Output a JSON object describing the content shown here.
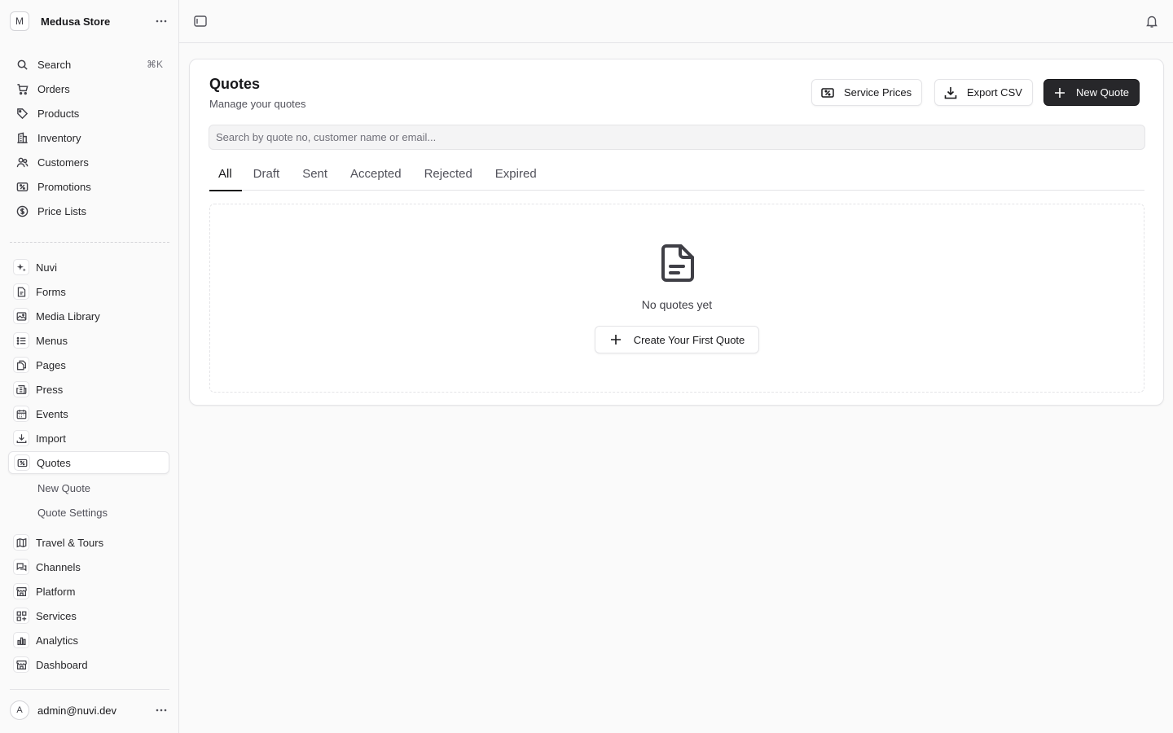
{
  "store": {
    "initial": "M",
    "name": "Medusa Store"
  },
  "search": {
    "label": "Search",
    "shortcut": "⌘K"
  },
  "nav_main": [
    {
      "label": "Orders",
      "icon": "cart-icon"
    },
    {
      "label": "Products",
      "icon": "tag-icon"
    },
    {
      "label": "Inventory",
      "icon": "building-icon"
    },
    {
      "label": "Customers",
      "icon": "users-icon"
    },
    {
      "label": "Promotions",
      "icon": "receipt-percent-icon"
    },
    {
      "label": "Price Lists",
      "icon": "currency-dollar-icon"
    }
  ],
  "nav_ext": [
    {
      "label": "Nuvi",
      "icon": "sparkles-icon"
    },
    {
      "label": "Forms",
      "icon": "document-text-icon"
    },
    {
      "label": "Media Library",
      "icon": "photo-icon"
    },
    {
      "label": "Menus",
      "icon": "list-bullet-icon"
    },
    {
      "label": "Pages",
      "icon": "documents-icon"
    },
    {
      "label": "Press",
      "icon": "newspaper-icon"
    },
    {
      "label": "Events",
      "icon": "calendar-icon"
    },
    {
      "label": "Import",
      "icon": "arrow-down-tray-icon"
    },
    {
      "label": "Quotes",
      "icon": "receipt-percent-icon"
    }
  ],
  "quotes_sub": [
    "New Quote",
    "Quote Settings"
  ],
  "nav_more": [
    {
      "label": "Travel & Tours",
      "icon": "map-icon"
    },
    {
      "label": "Channels",
      "icon": "chat-bubbles-icon"
    },
    {
      "label": "Platform",
      "icon": "building-storefront-icon"
    },
    {
      "label": "Services",
      "icon": "squares-plus-icon"
    },
    {
      "label": "Analytics",
      "icon": "chart-bar-icon"
    },
    {
      "label": "Dashboard",
      "icon": "building-storefront-icon"
    }
  ],
  "user": {
    "initial": "A",
    "email": "admin@nuvi.dev"
  },
  "page": {
    "title": "Quotes",
    "subtitle": "Manage your quotes",
    "buttons": {
      "service_prices": "Service Prices",
      "export_csv": "Export CSV",
      "new_quote": "New Quote"
    },
    "search_placeholder": "Search by quote no, customer name or email...",
    "tabs": [
      "All",
      "Draft",
      "Sent",
      "Accepted",
      "Rejected",
      "Expired"
    ],
    "active_tab": "All",
    "empty": {
      "message": "No quotes yet",
      "cta": "Create Your First Quote"
    }
  }
}
